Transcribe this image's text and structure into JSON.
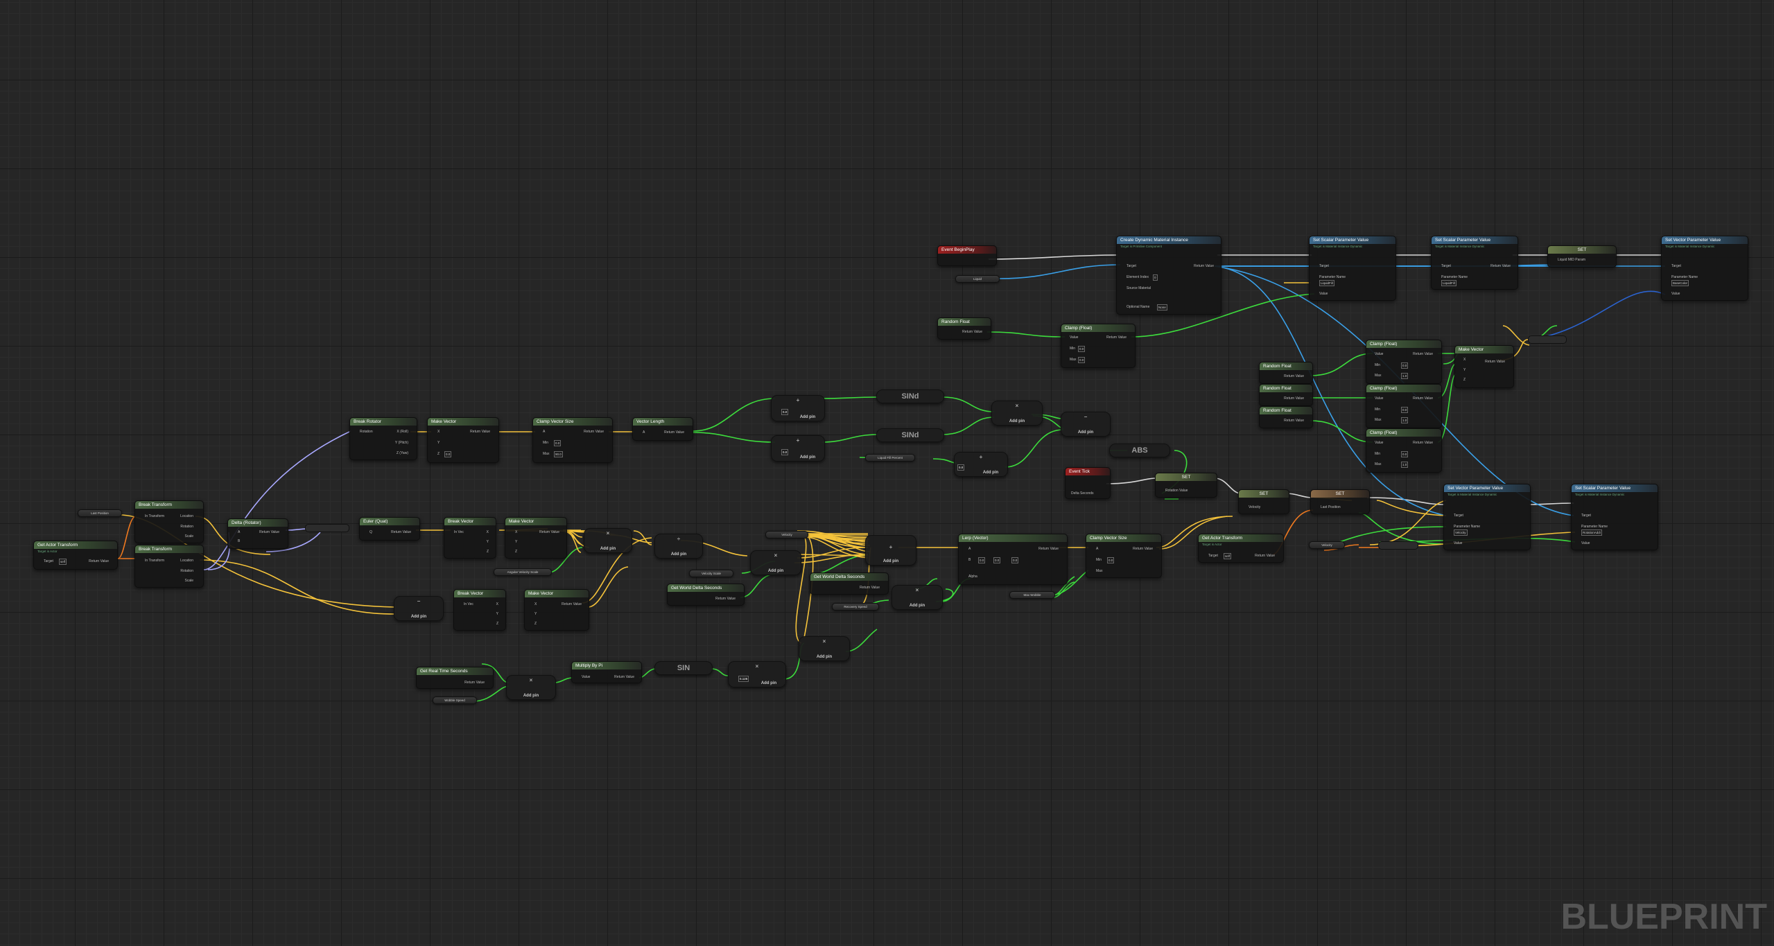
{
  "app": {
    "watermark": "BLUEPRINT"
  },
  "colors": {
    "exec": "#ffffff",
    "float": "#3ddc3d",
    "vector": "#f5c33b",
    "rotator": "#a9a9ff",
    "object": "#3aa0e8",
    "transform": "#f07a20",
    "struct": "#2b63d0"
  },
  "nodes": {
    "event_beginplay": {
      "title": "Event BeginPlay"
    },
    "event_tick": {
      "title": "Event Tick",
      "delta": "Delta Seconds"
    },
    "create_dmi": {
      "title": "Create Dynamic Material Instance",
      "subtitle": "Target is Primitive Component",
      "target": "Target",
      "element_index": "Element Index",
      "element_index_val": "0",
      "source_material": "Source Material",
      "optional_name": "Optional Name",
      "optional_name_val": "None",
      "return": "Return Value"
    },
    "set_scalar_1": {
      "title": "Set Scalar Parameter Value",
      "subtitle": "Target is Material Instance Dynamic",
      "target": "Target",
      "param": "Parameter Name",
      "param_val": "LiquidFill",
      "value": "Value"
    },
    "set_scalar_2": {
      "title": "Set Scalar Parameter Value",
      "subtitle": "Target is Material Instance Dynamic",
      "target": "Target",
      "param": "Parameter Name",
      "param_val": "LiquidFill",
      "return": "Return Value"
    },
    "set_top": {
      "title": "SET",
      "pin": "Liquid MID Param"
    },
    "set_vector_top": {
      "title": "Set Vector Parameter Value",
      "subtitle": "Target is Material Instance Dynamic",
      "target": "Target",
      "param": "Parameter Name",
      "param_val": "BaseColor",
      "value": "Value"
    },
    "liquid_var": {
      "label": "Liquid"
    },
    "random_float_1": {
      "title": "Random Float",
      "return": "Return Value"
    },
    "clamp_float_1": {
      "title": "Clamp (Float)",
      "value": "Value",
      "min": "Min",
      "min_val": "0.0",
      "max": "Max",
      "max_val": "0.0",
      "return": "Return Value"
    },
    "random_float_2": {
      "title": "Random Float",
      "return": "Return Value"
    },
    "random_float_3": {
      "title": "Random Float",
      "return": "Return Value"
    },
    "random_float_4": {
      "title": "Random Float",
      "return": "Return Value"
    },
    "clamp_float_2": {
      "title": "Clamp (Float)",
      "value": "Value",
      "min": "Min",
      "max": "Max",
      "v1": "0.0",
      "v2": "1.0",
      "return": "Return Value"
    },
    "clamp_float_3": {
      "title": "Clamp (Float)",
      "value": "Value",
      "min": "Min",
      "max": "Max",
      "v1": "0.0",
      "v2": "1.0",
      "return": "Return Value"
    },
    "clamp_float_4": {
      "title": "Clamp (Float)",
      "value": "Value",
      "min": "Min",
      "max": "Max",
      "v1": "0.0",
      "v2": "1.0",
      "return": "Return Value"
    },
    "make_vector_top": {
      "title": "Make Vector",
      "x": "X",
      "y": "Y",
      "z": "Z",
      "return": "Return Value"
    },
    "break_rotator": {
      "title": "Break Rotator",
      "rot": "Rotation",
      "x": "X (Roll)",
      "y": "Y (Pitch)",
      "z": "Z (Yaw)"
    },
    "make_vector_1": {
      "title": "Make Vector",
      "x": "X",
      "y": "Y",
      "z": "Z",
      "z_val": "0.0",
      "return": "Return Value"
    },
    "clamp_vector_size": {
      "title": "Clamp Vector Size",
      "a": "A",
      "min": "Min",
      "min_val": "0.0",
      "max": "Max",
      "max_val": "90.0",
      "return": "Return Value"
    },
    "vector_length": {
      "title": "Vector Length",
      "a": "A",
      "return": "Return Value"
    },
    "add_1": {
      "op": "+",
      "val": "0.0",
      "add": "Add pin"
    },
    "add_2": {
      "op": "+",
      "val": "0.0",
      "add": "Add pin"
    },
    "sind_1": {
      "label": "SINd"
    },
    "sind_2": {
      "label": "SINd"
    },
    "mul_1": {
      "op": "×",
      "add": "Add pin"
    },
    "mul_2": {
      "op": "+",
      "val": "0.0",
      "add": "Add pin"
    },
    "sub_1": {
      "op": "−",
      "add": "Add pin"
    },
    "abs_1": {
      "label": "ABS"
    },
    "liquid_fill_var": {
      "label": "Liquid Fill Percent"
    },
    "set_mid": {
      "title": "SET",
      "pin": "Rotation Value"
    },
    "set_vel": {
      "title": "SET",
      "pin": "Velocity"
    },
    "set_last": {
      "title": "SET",
      "pin": "Last Position"
    },
    "set_vec_param_2": {
      "title": "Set Vector Parameter Value",
      "subtitle": "Target is Material Instance Dynamic",
      "target": "Target",
      "param": "Parameter Name",
      "param_val": "Velocity",
      "value": "Value"
    },
    "set_scalar_3": {
      "title": "Set Scalar Parameter Value",
      "subtitle": "Target is Material Instance Dynamic",
      "target": "Target",
      "param": "Parameter Name",
      "param_val": "RotationAddi",
      "value": "Value"
    },
    "velocity_var": {
      "label": "Velocity"
    },
    "get_actor_transform_main": {
      "title": "Get Actor Transform",
      "subtitle": "Target is Actor",
      "target": "Target",
      "target_val": "self",
      "return": "Return Value"
    },
    "last_position_var": {
      "label": "Last Position"
    },
    "break_transform_1": {
      "title": "Break Transform",
      "in": "In Transform",
      "loc": "Location",
      "rot": "Rotation",
      "scale": "Scale"
    },
    "break_transform_2": {
      "title": "Break Transform",
      "in": "In Transform",
      "loc": "Location",
      "rot": "Rotation",
      "scale": "Scale"
    },
    "delta_rotator": {
      "title": "Delta (Rotator)",
      "a": "A",
      "b": "B",
      "return": "Return Value"
    },
    "euler_quat": {
      "title": "Euler (Quat)",
      "q": "Q",
      "return": "Return Value"
    },
    "break_vector_1": {
      "title": "Break Vector",
      "in": "In Vec",
      "x": "X",
      "y": "Y",
      "z": "Z"
    },
    "make_vector_2": {
      "title": "Make Vector",
      "x": "X",
      "y": "Y",
      "z": "Z",
      "return": "Return Value"
    },
    "mul_vec_1": {
      "op": "×",
      "add": "Add pin"
    },
    "div_vec_1": {
      "op": "÷",
      "add": "Add pin"
    },
    "angular_vel_var": {
      "label": "Angular Velocity Scale"
    },
    "sub_vec_1": {
      "op": "−",
      "add": "Add pin"
    },
    "break_vector_2": {
      "title": "Break Vector",
      "in": "In Vec",
      "x": "X",
      "y": "Y",
      "z": "Z"
    },
    "make_vector_3": {
      "title": "Make Vector",
      "x": "X",
      "y": "Y",
      "z": "Z",
      "return": "Return Value"
    },
    "velocity_var_2": {
      "label": "Velocity"
    },
    "velocity_scale_var": {
      "label": "Velocity Scale"
    },
    "world_delta_1": {
      "title": "Get World Delta Seconds",
      "return": "Return Value"
    },
    "mul_vec_2": {
      "op": "×",
      "add": "Add pin"
    },
    "world_delta_2": {
      "title": "Get World Delta Seconds",
      "return": "Return Value"
    },
    "recovery_speed_var": {
      "label": "Recovery Speed"
    },
    "mul_vec_3": {
      "op": "×",
      "add": "Add pin"
    },
    "add_vec_1": {
      "op": "+",
      "add": "Add pin"
    },
    "mul_vec_4": {
      "op": "×",
      "add": "Add pin"
    },
    "lerp_vector": {
      "title": "Lerp (Vector)",
      "a": "A",
      "b": "B",
      "alpha": "Alpha",
      "b_x": "0.0",
      "b_y": "0.0",
      "b_z": "0.0",
      "return": "Return Value"
    },
    "max_wobble_var": {
      "label": "Max Wobble"
    },
    "clamp_vector_size_2": {
      "title": "Clamp Vector Size",
      "a": "A",
      "min": "Min",
      "min_val": "0.0",
      "max": "Max",
      "return": "Return Value"
    },
    "get_actor_transform_2": {
      "title": "Get Actor Transform",
      "subtitle": "Target is Actor",
      "target": "Target",
      "target_val": "self",
      "return": "Return Value"
    },
    "velocity_var_3": {
      "label": "Velocity"
    },
    "get_real_time": {
      "title": "Get Real Time Seconds",
      "return": "Return Value"
    },
    "wobble_speed_var": {
      "label": "Wobble Speed"
    },
    "mul_time": {
      "op": "×",
      "add": "Add pin"
    },
    "multiply_pi": {
      "title": "Multiply By Pi",
      "value": "Value",
      "return": "Return Value"
    },
    "sin_1": {
      "label": "SIN"
    },
    "mul_sin": {
      "op": "×",
      "val": "0.125",
      "add": "Add pin"
    }
  }
}
